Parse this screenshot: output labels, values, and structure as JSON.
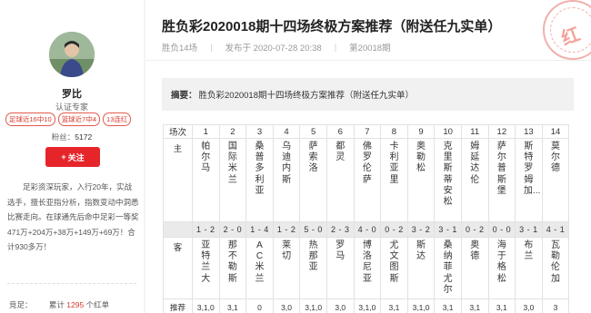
{
  "profile": {
    "name": "罗比",
    "role": "认证专家",
    "badges": [
      "足球近16中10",
      "篮球近7中4",
      "13连红"
    ],
    "fans_label": "粉丝：",
    "fans_count": "5172",
    "follow_label": "关注",
    "bio": "足彩资深玩家，入行20年，实战选手，擅长亚指分析，指数变动中洞悉比赛走向。在球通先后命中足彩一等奖471万+204万+38万+149万+69万！合计930多万！",
    "stat_label": "竞足：",
    "stat_prefix": "累计",
    "stat_value": "1295",
    "stat_suffix": "个红单"
  },
  "article": {
    "title": "胜负彩2020018期十四场终极方案推荐（附送任九实单）",
    "meta_category": "胜负14场",
    "meta_date": "发布于 2020-07-28 20:38",
    "meta_issue": "第20018期",
    "stamp_char": "红",
    "summary_label": "摘要：",
    "summary_text": "胜负彩2020018期十四场终极方案推荐（附送任九实单）"
  },
  "table": {
    "label_match": "场次",
    "label_home": "主",
    "label_guest": "客",
    "label_rec": "推荐",
    "rows": [
      {
        "no": "1",
        "home": "帕尔马",
        "score": "1 - 2",
        "guest": "亚特兰大",
        "rec": "3,1,0"
      },
      {
        "no": "2",
        "home": "国际米兰",
        "score": "2 - 0",
        "guest": "那不勒斯",
        "rec": "3,1"
      },
      {
        "no": "3",
        "home": "桑普多利亚",
        "score": "1 - 4",
        "guest": "AC米兰",
        "rec": "0"
      },
      {
        "no": "4",
        "home": "乌迪内斯",
        "score": "1 - 2",
        "guest": "莱切",
        "rec": "3,0"
      },
      {
        "no": "5",
        "home": "萨索洛",
        "score": "5 - 0",
        "guest": "热那亚",
        "rec": "3,1,0"
      },
      {
        "no": "6",
        "home": "都灵",
        "score": "2 - 3",
        "guest": "罗马",
        "rec": "3,0"
      },
      {
        "no": "7",
        "home": "佛罗伦萨",
        "score": "4 - 0",
        "guest": "博洛尼亚",
        "rec": "3,1,0"
      },
      {
        "no": "8",
        "home": "卡利亚里",
        "score": "0 - 2",
        "guest": "尤文图斯",
        "rec": "3,1"
      },
      {
        "no": "9",
        "home": "奥勒松",
        "score": "3 - 2",
        "guest": "斯达",
        "rec": "3,1,0"
      },
      {
        "no": "10",
        "home": "克里斯蒂安松",
        "score": "3 - 1",
        "guest": "桑纳菲尤尔",
        "rec": "3,1"
      },
      {
        "no": "11",
        "home": "姆延达伦",
        "score": "0 - 2",
        "guest": "奥德",
        "rec": "3,1"
      },
      {
        "no": "12",
        "home": "萨尔普斯堡",
        "score": "0 - 0",
        "guest": "海于格松",
        "rec": "3,1"
      },
      {
        "no": "13",
        "home": "斯特罗姆加...",
        "score": "3 - 1",
        "guest": "布兰",
        "rec": "3,0"
      },
      {
        "no": "14",
        "home": "莫尔德",
        "score": "4 - 1",
        "guest": "瓦勒伦加",
        "rec": "3"
      }
    ]
  }
}
